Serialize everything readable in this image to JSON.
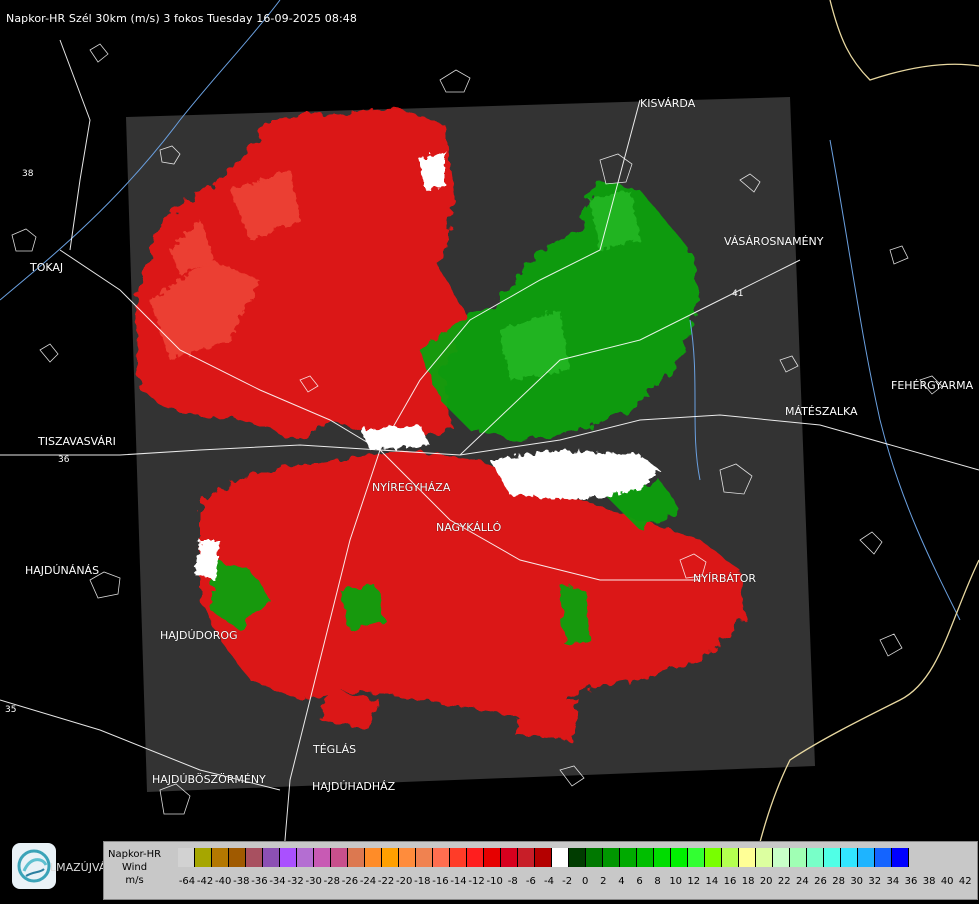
{
  "header": {
    "title": "Napkor-HR Szél 30km (m/s) 3 fokos Tuesday 16-09-2025 08:48"
  },
  "cities": [
    {
      "id": "kisvarda",
      "label": "KISVÁRDA"
    },
    {
      "id": "tokaj",
      "label": "TOKAJ"
    },
    {
      "id": "vasarosnameny",
      "label": "VÁSÁROSNAMÉNY"
    },
    {
      "id": "fehergyarmat",
      "label": "FEHÉRGYARMA"
    },
    {
      "id": "mateszalka",
      "label": "MÁTÉSZALKA"
    },
    {
      "id": "tiszavasvari",
      "label": "TISZAVASVÁRI"
    },
    {
      "id": "nyiregyhaza",
      "label": "NYÍREGYHÁZA"
    },
    {
      "id": "nagykallo",
      "label": "NAGYKÁLLÓ"
    },
    {
      "id": "hajdunanas",
      "label": "HAJDÚNÁNÁS"
    },
    {
      "id": "nyirbator",
      "label": "NYÍRBÁTOR"
    },
    {
      "id": "hajdudorog",
      "label": "HAJDÚDOROG"
    },
    {
      "id": "teglas",
      "label": "TÉGLÁS"
    },
    {
      "id": "hajduboszormeny",
      "label": "HAJDÚBÖSZÖRMÉNY"
    },
    {
      "id": "hajduhadhaz",
      "label": "HAJDÚHADHÁZ"
    }
  ],
  "roads": [
    {
      "id": "road-38",
      "label": "38"
    },
    {
      "id": "road-36",
      "label": "36"
    },
    {
      "id": "road-41",
      "label": "41"
    },
    {
      "id": "road-35",
      "label": "35"
    }
  ],
  "logo_text": "LMAZÚJVÁR",
  "legend": {
    "title_lines": [
      "Napkor-HR",
      "Wind",
      "m/s"
    ],
    "colors": [
      "#d2d2d2",
      "#a6a600",
      "#b47800",
      "#a05a00",
      "#a85060",
      "#8c50b4",
      "#aa50ff",
      "#b46ed2",
      "#c85ab4",
      "#c8508c",
      "#dc7850",
      "#ff8c28",
      "#ffa000",
      "#ff8c3c",
      "#f08250",
      "#ff6e50",
      "#ff3c28",
      "#ff1e1e",
      "#e60000",
      "#d7001e",
      "#c81e28",
      "#b40000",
      "#ffffff",
      "#003c00",
      "#007800",
      "#009600",
      "#00aa00",
      "#00be00",
      "#00dc00",
      "#00f000",
      "#32ff32",
      "#78ff00",
      "#b4ff50",
      "#ffff96",
      "#dcffa0",
      "#c8ffc8",
      "#a0ffb4",
      "#78ffc8",
      "#50ffe6",
      "#32e6ff",
      "#1eb4ff",
      "#1464ff",
      "#0000ff"
    ],
    "ticks": [
      "-64",
      "-42",
      "-40",
      "-38",
      "-36",
      "-34",
      "-32",
      "-30",
      "-28",
      "-26",
      "-24",
      "-22",
      "-20",
      "-18",
      "-16",
      "-14",
      "-12",
      "-10",
      "-8",
      "-6",
      "-4",
      "-2",
      "0",
      "2",
      "4",
      "6",
      "8",
      "10",
      "12",
      "14",
      "16",
      "18",
      "20",
      "22",
      "24",
      "26",
      "28",
      "30",
      "32",
      "34",
      "36",
      "38",
      "40",
      "42"
    ]
  },
  "colors": {
    "background": "#000000",
    "radar_frame": "#333333",
    "approaching": "#00a000",
    "receding": "#e00000",
    "border": "#e8d8a0",
    "river": "#6aa0e0"
  }
}
